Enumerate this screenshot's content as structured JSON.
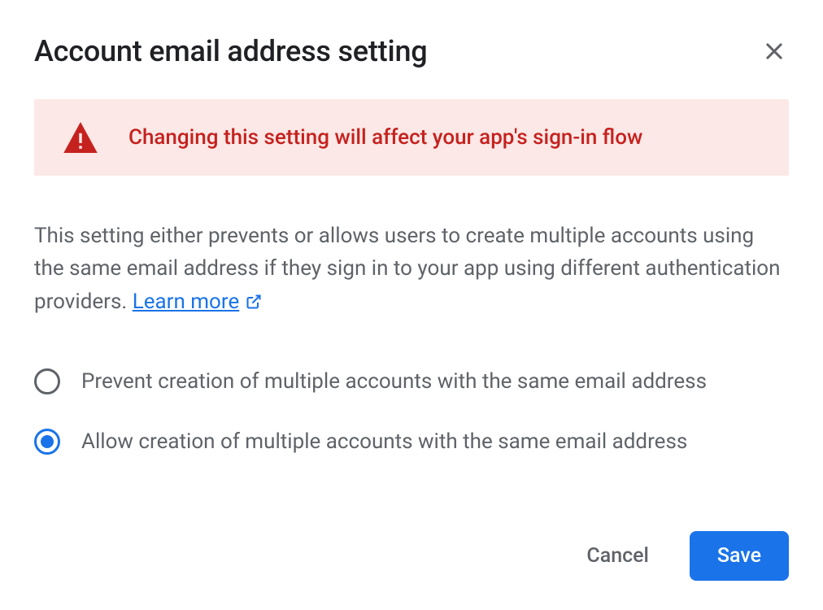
{
  "dialog": {
    "title": "Account email address setting",
    "warning": "Changing this setting will affect your app's sign-in flow",
    "description": "This setting either prevents or allows users to create multiple accounts using the same email address if they sign in to your app using different authentication providers. ",
    "learn_more": "Learn more",
    "options": {
      "prevent": "Prevent creation of multiple accounts with the same email address",
      "allow": "Allow creation of multiple accounts with the same email address"
    },
    "selected": "allow",
    "buttons": {
      "cancel": "Cancel",
      "save": "Save"
    }
  }
}
